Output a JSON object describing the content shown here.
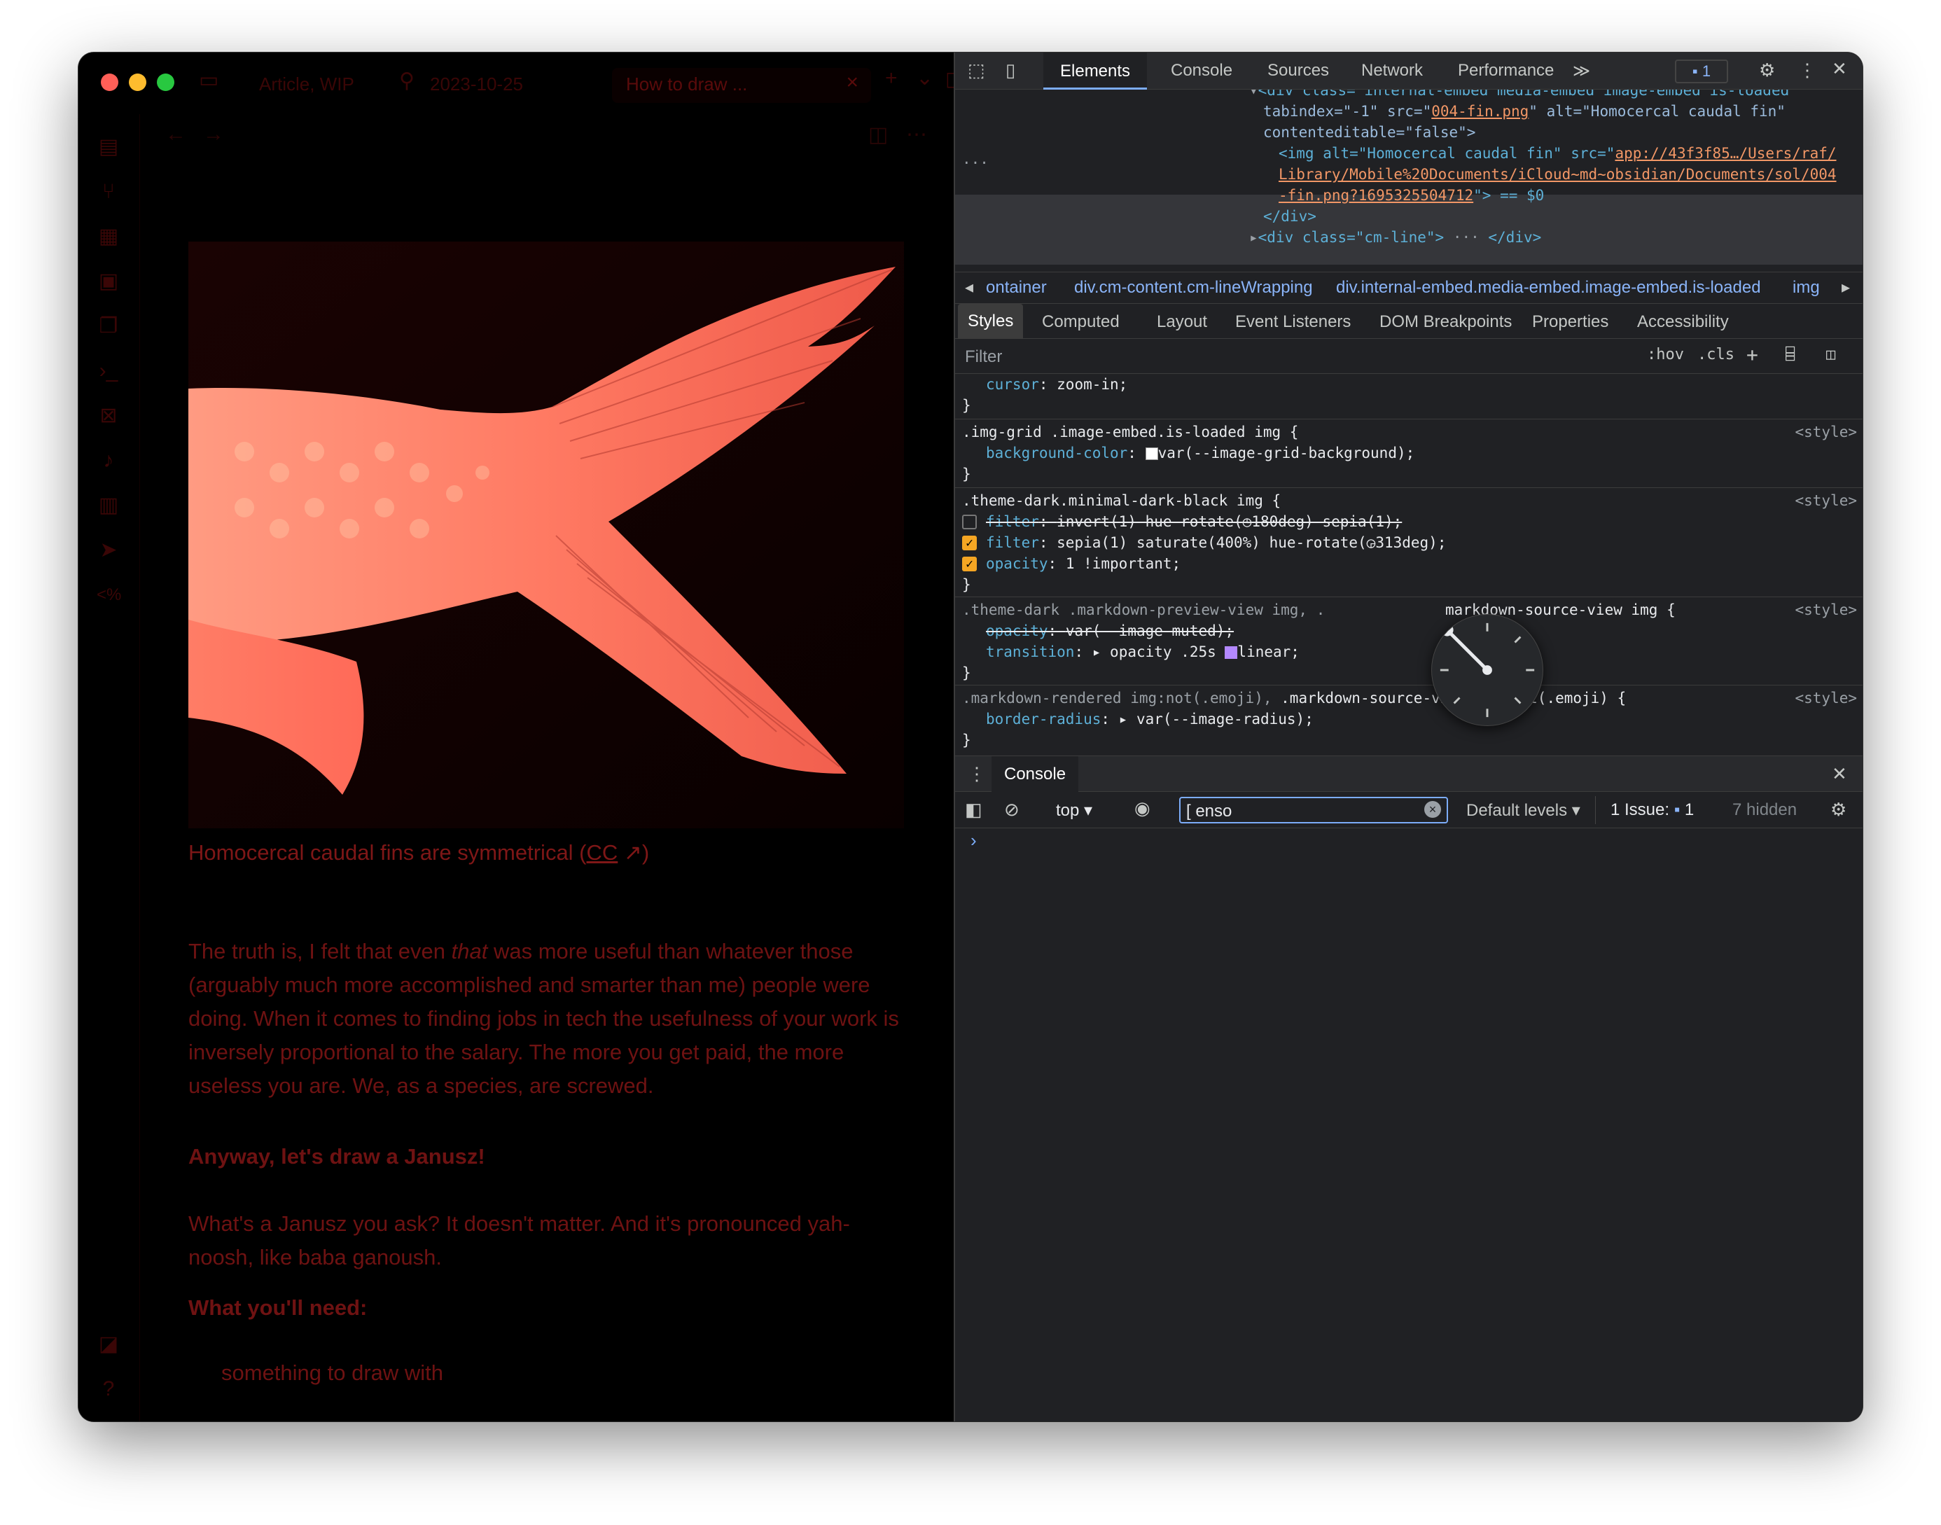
{
  "left_pane": {
    "tab_group_label": "Article, WIP",
    "tab_date": "2023-10-25",
    "active_tab_title": "How to draw ...",
    "image_alt": "Homocercal caudal fin",
    "caption_text": "Homocercal caudal fins are symmetrical (",
    "caption_link": "CC",
    "caption_close": ")",
    "p1_pre": "The truth is, I felt that even ",
    "p1_em": "that",
    "p1_post": " was more useful than whatever those (arguably much more accomplished and smarter than me) people were doing. When it comes to finding jobs in tech the usefulness of your work is inversely proportional to the salary. The more you get paid, the more useless you are. We, as a species, are screwed.",
    "p2": "Anyway, let's draw a Janusz!",
    "p3": "What's a Janusz you ask? It doesn't matter. And it's pronounced yah-noosh, like baba ganoush.",
    "p4": "What you'll need:",
    "list_item_1": "something to draw with"
  },
  "devtools": {
    "tabs": [
      "Elements",
      "Console",
      "Sources",
      "Network",
      "Performance"
    ],
    "more_tabs": "≫",
    "issues_badge": "1",
    "dom_lines": {
      "l1_tag": "<div class=\"internal-embed media-embed image-embed is-loaded\"",
      "l2": "tabindex=\"-1\" src=\"",
      "l2_link": "004-fin.png",
      "l2_post": "\" alt=\"Homocercal caudal fin\"",
      "l3": "contenteditable=\"false\">",
      "l4_pre": "<img alt=\"Homocercal caudal fin\" src=\"",
      "l4_link": "app://43f3f85…/Users/raf/",
      "l5_link": "Library/Mobile%20Documents/iCloud~md~obsidian/Documents/sol/004",
      "l6_link": "-fin.png?1695325504712",
      "l6_post": "\"> == $0",
      "l7": "</div>",
      "l8": "<div class=\"cm-line\">",
      "l8_post": "</div>",
      "ellipsis": "···"
    },
    "breadcrumbs": [
      "ontainer",
      "div.cm-content.cm-lineWrapping",
      "div.internal-embed.media-embed.image-embed.is-loaded",
      "img"
    ],
    "style_tabs": [
      "Styles",
      "Computed",
      "Layout",
      "Event Listeners",
      "DOM Breakpoints",
      "Properties",
      "Accessibility"
    ],
    "filter_placeholder": "Filter",
    "filter_hov": ":hov",
    "filter_cls": ".cls",
    "rules": {
      "r0_prop": "cursor",
      "r0_val": "zoom-in;",
      "r1_sel": ".img-grid .image-embed.is-loaded img {",
      "r1_prop": "background-color",
      "r1_val": "var(--image-grid-background);",
      "r2_sel": ".theme-dark.minimal-dark-black img {",
      "r2_p1": "filter",
      "r2_v1": "invert(1) hue-rotate(",
      "r2_v1b": "180deg) sepia(1);",
      "r2_p2": "filter",
      "r2_v2": "sepia(1) saturate(400%) hue-rotate(",
      "r2_v2b": "313deg);",
      "r2_p3": "opacity",
      "r2_v3": "1 !important;",
      "r3_sel_a": ".theme-dark .markdown-preview-view img, .",
      "r3_sel_b": "markdown-source-view img {",
      "r3_p1": "opacity",
      "r3_v1": "var(--image-muted);",
      "r3_p2": "transition",
      "r3_v2": "opacity .25s",
      "r3_v2b": "linear;",
      "r4_sel_a": ".markdown-rendered img:not(.emoji), ",
      "r4_sel_b": ".markdown-source-view img:not(.emoji) {",
      "r4_prop": "border-radius",
      "r4_val": "var(--image-radius);",
      "close": "}",
      "source": "<style>"
    },
    "drawer_tab": "Console",
    "console_context": "top",
    "console_filter_value": "[ enso",
    "default_levels": "Default levels",
    "issue_label": "1 Issue:",
    "issue_count": "1",
    "hidden_count": "7 hidden",
    "prompt": "›"
  },
  "colors": {
    "accent": "#7cacf8",
    "fish": "#ff6a5a",
    "text_red": "#6e1212"
  }
}
